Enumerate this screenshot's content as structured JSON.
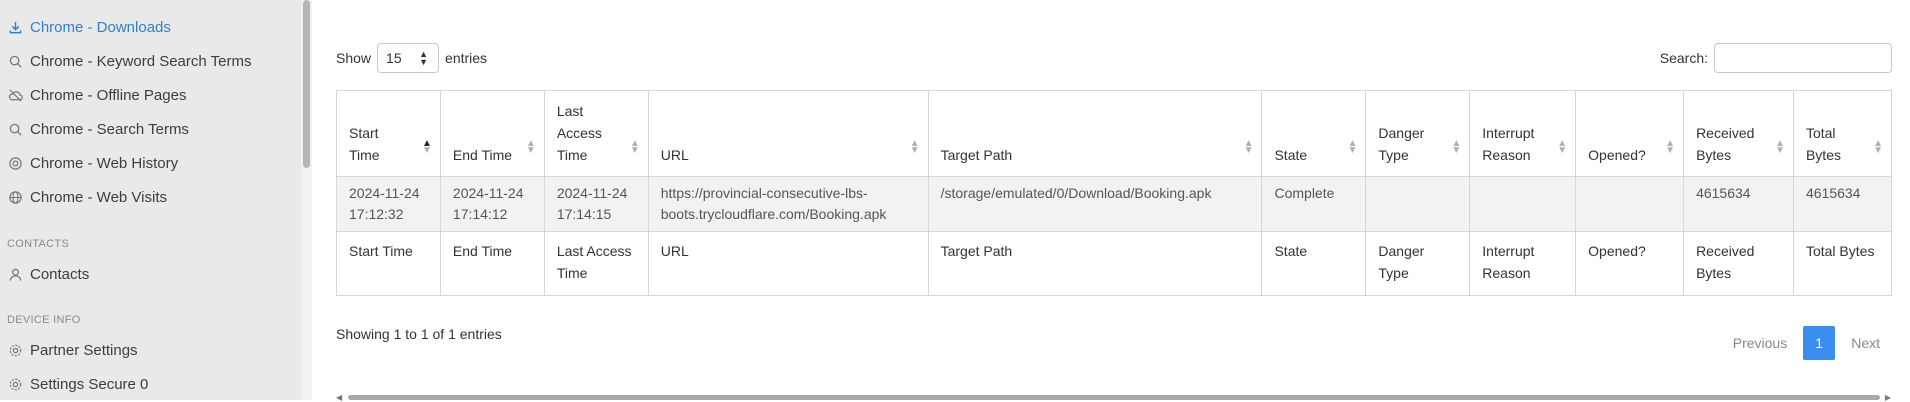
{
  "sidebar": {
    "items": [
      {
        "label": "Chrome - Downloads",
        "icon": "download-icon",
        "active": true
      },
      {
        "label": "Chrome - Keyword Search Terms",
        "icon": "search-icon"
      },
      {
        "label": "Chrome - Offline Pages",
        "icon": "cloud-off-icon"
      },
      {
        "label": "Chrome - Search Terms",
        "icon": "search-icon"
      },
      {
        "label": "Chrome - Web History",
        "icon": "history-icon"
      },
      {
        "label": "Chrome - Web Visits",
        "icon": "globe-icon"
      }
    ],
    "section_contacts": "CONTACTS",
    "contacts": {
      "label": "Contacts",
      "icon": "person-icon"
    },
    "section_device": "DEVICE INFO",
    "device_items": [
      {
        "label": "Partner Settings",
        "icon": "gear-icon"
      },
      {
        "label": "Settings Secure 0",
        "icon": "gear-icon"
      }
    ]
  },
  "toolbar": {
    "show_label": "Show",
    "show_value": "15",
    "entries_label": "entries",
    "search_label": "Search:",
    "search_value": ""
  },
  "table": {
    "headers": [
      "Start Time",
      "End Time",
      "Last Access Time",
      "URL",
      "Target Path",
      "State",
      "Danger Type",
      "Interrupt Reason",
      "Opened?",
      "Received Bytes",
      "Total Bytes"
    ],
    "header_display": [
      [
        "Start",
        "Time"
      ],
      [
        "End Time"
      ],
      [
        "Last",
        "Access",
        "Time"
      ],
      [
        "URL"
      ],
      [
        "Target Path"
      ],
      [
        "State"
      ],
      [
        "Danger",
        "Type"
      ],
      [
        "Interrupt",
        "Reason"
      ],
      [
        "Opened?"
      ],
      [
        "Received",
        "Bytes"
      ],
      [
        "Total",
        "Bytes"
      ]
    ],
    "rows": [
      {
        "start_time": [
          "2024-11-24",
          "17:12:32"
        ],
        "end_time": [
          "2024-11-24",
          "17:14:12"
        ],
        "last_access_time": [
          "2024-11-24",
          "17:14:15"
        ],
        "url": [
          "https://provincial-consecutive-lbs-",
          "boots.trycloudflare.com/Booking.apk"
        ],
        "target_path": "/storage/emulated/0/Download/Booking.apk",
        "state": "Complete",
        "danger_type": "",
        "interrupt_reason": "",
        "opened": "",
        "received_bytes": "4615634",
        "total_bytes": "4615634"
      }
    ],
    "footer_display": [
      [
        "Start Time"
      ],
      [
        "End Time"
      ],
      [
        "Last Access",
        "Time"
      ],
      [
        "URL"
      ],
      [
        "Target Path"
      ],
      [
        "State"
      ],
      [
        "Danger",
        "Type"
      ],
      [
        "Interrupt",
        "Reason"
      ],
      [
        "Opened?"
      ],
      [
        "Received",
        "Bytes"
      ],
      [
        "Total Bytes"
      ]
    ]
  },
  "info": "Showing 1 to 1 of 1 entries",
  "pagination": {
    "previous": "Previous",
    "current": "1",
    "next": "Next"
  },
  "colors": {
    "accent": "#3b8df0",
    "active_link": "#2f7fd1",
    "sidebar_bg": "#e9e9e9"
  }
}
